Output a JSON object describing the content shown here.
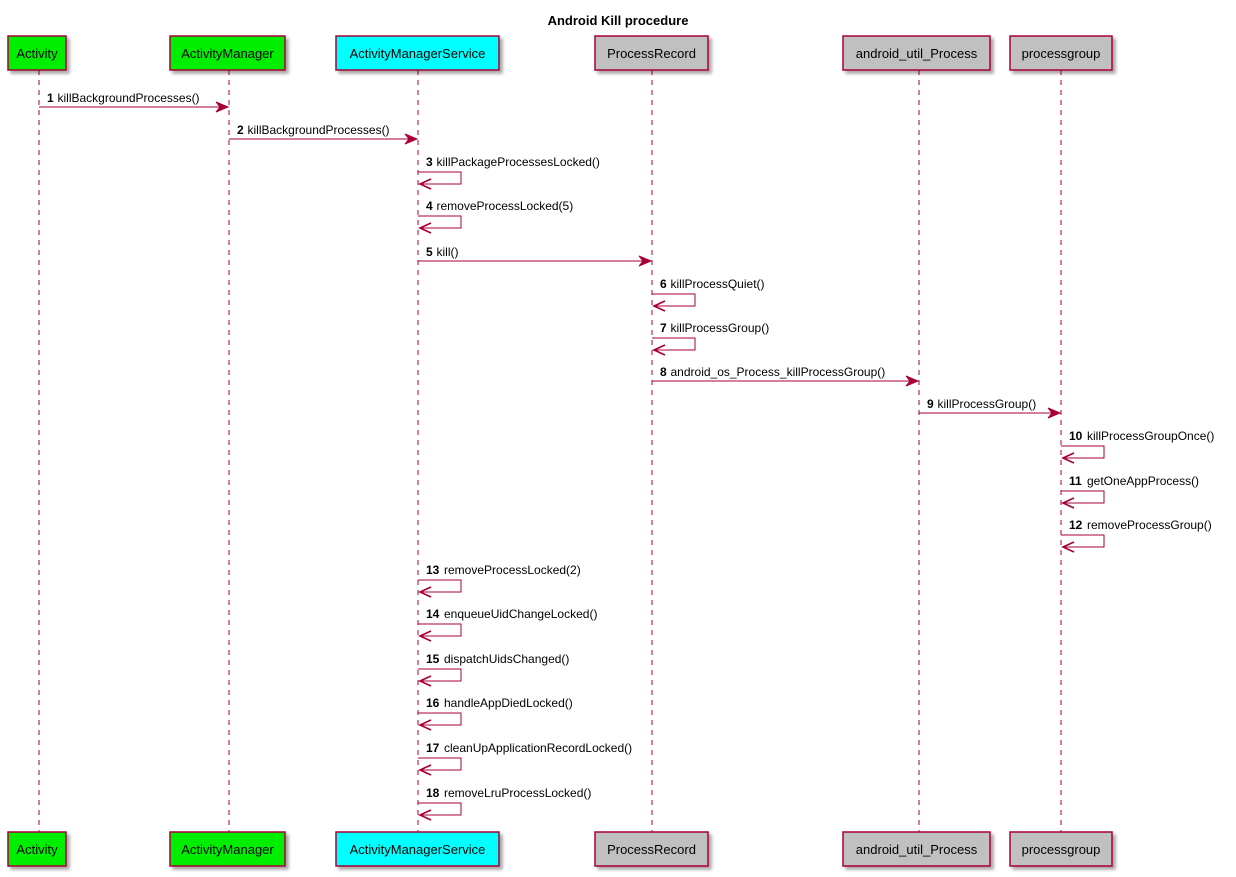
{
  "title": "Android Kill procedure",
  "colors": {
    "line": "#A80036",
    "border": "#A80036",
    "shadow": "#c8c8c8"
  },
  "participants": [
    {
      "id": "activity",
      "label": "Activity",
      "fill": "#00EE00"
    },
    {
      "id": "activitymanager",
      "label": "ActivityManager",
      "fill": "#00EE00"
    },
    {
      "id": "ams",
      "label": "ActivityManagerService",
      "fill": "#00FFFF"
    },
    {
      "id": "processrecord",
      "label": "ProcessRecord",
      "fill": "#C0C0C0"
    },
    {
      "id": "android_util_process",
      "label": "android_util_Process",
      "fill": "#C0C0C0"
    },
    {
      "id": "processgroup",
      "label": "processgroup",
      "fill": "#C0C0C0"
    }
  ],
  "messages": [
    {
      "num": "1",
      "text": "killBackgroundProcesses()",
      "from": 0,
      "to": 1
    },
    {
      "num": "2",
      "text": "killBackgroundProcesses()",
      "from": 1,
      "to": 2
    },
    {
      "num": "3",
      "text": "killPackageProcessesLocked()",
      "from": 2,
      "to": 2
    },
    {
      "num": "4",
      "text": "removeProcessLocked(5)",
      "from": 2,
      "to": 2
    },
    {
      "num": "5",
      "text": "kill()",
      "from": 2,
      "to": 3
    },
    {
      "num": "6",
      "text": "killProcessQuiet()",
      "from": 3,
      "to": 3
    },
    {
      "num": "7",
      "text": "killProcessGroup()",
      "from": 3,
      "to": 3
    },
    {
      "num": "8",
      "text": "android_os_Process_killProcessGroup()",
      "from": 3,
      "to": 4
    },
    {
      "num": "9",
      "text": "killProcessGroup()",
      "from": 4,
      "to": 5
    },
    {
      "num": "10",
      "text": "killProcessGroupOnce()",
      "from": 5,
      "to": 5
    },
    {
      "num": "11",
      "text": "getOneAppProcess()",
      "from": 5,
      "to": 5
    },
    {
      "num": "12",
      "text": "removeProcessGroup()",
      "from": 5,
      "to": 5
    },
    {
      "num": "13",
      "text": "removeProcessLocked(2)",
      "from": 2,
      "to": 2
    },
    {
      "num": "14",
      "text": "enqueueUidChangeLocked()",
      "from": 2,
      "to": 2
    },
    {
      "num": "15",
      "text": "dispatchUidsChanged()",
      "from": 2,
      "to": 2
    },
    {
      "num": "16",
      "text": "handleAppDiedLocked()",
      "from": 2,
      "to": 2
    },
    {
      "num": "17",
      "text": "cleanUpApplicationRecordLocked()",
      "from": 2,
      "to": 2
    },
    {
      "num": "18",
      "text": "removeLruProcessLocked()",
      "from": 2,
      "to": 2
    }
  ]
}
